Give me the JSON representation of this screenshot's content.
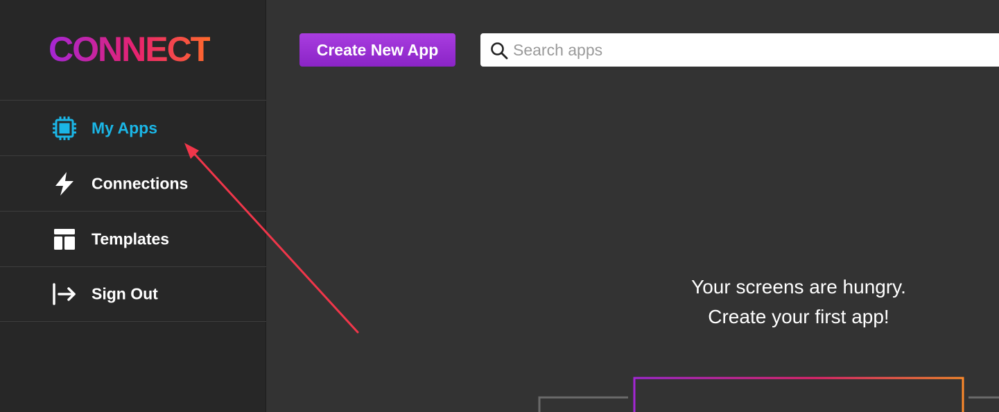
{
  "app": {
    "logo_text": "CONNECT"
  },
  "sidebar": {
    "items": [
      {
        "label": "My Apps",
        "icon": "chip-icon",
        "active": true
      },
      {
        "label": "Connections",
        "icon": "lightning-icon",
        "active": false
      },
      {
        "label": "Templates",
        "icon": "layout-icon",
        "active": false
      },
      {
        "label": "Sign Out",
        "icon": "sign-out-icon",
        "active": false
      }
    ]
  },
  "toolbar": {
    "create_label": "Create New App"
  },
  "search": {
    "placeholder": "Search apps",
    "value": ""
  },
  "empty_state": {
    "line1": "Your screens are hungry.",
    "line2": "Create your first app!"
  },
  "colors": {
    "accent_active": "#1bb6e6",
    "button_purple": "#9b30d6",
    "annotation_arrow": "#f0364a",
    "logo_gradient": [
      "#a426d6",
      "#e8236e",
      "#ff6a2b"
    ]
  }
}
